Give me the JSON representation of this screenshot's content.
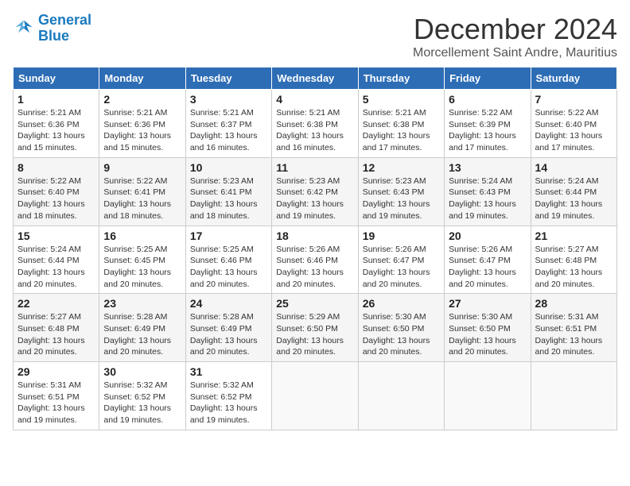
{
  "logo": {
    "line1": "General",
    "line2": "Blue"
  },
  "title": "December 2024",
  "subtitle": "Morcellement Saint Andre, Mauritius",
  "weekdays": [
    "Sunday",
    "Monday",
    "Tuesday",
    "Wednesday",
    "Thursday",
    "Friday",
    "Saturday"
  ],
  "weeks": [
    [
      {
        "day": "1",
        "sunrise": "5:21 AM",
        "sunset": "6:36 PM",
        "daylight": "13 hours and 15 minutes."
      },
      {
        "day": "2",
        "sunrise": "5:21 AM",
        "sunset": "6:36 PM",
        "daylight": "13 hours and 15 minutes."
      },
      {
        "day": "3",
        "sunrise": "5:21 AM",
        "sunset": "6:37 PM",
        "daylight": "13 hours and 16 minutes."
      },
      {
        "day": "4",
        "sunrise": "5:21 AM",
        "sunset": "6:38 PM",
        "daylight": "13 hours and 16 minutes."
      },
      {
        "day": "5",
        "sunrise": "5:21 AM",
        "sunset": "6:38 PM",
        "daylight": "13 hours and 17 minutes."
      },
      {
        "day": "6",
        "sunrise": "5:22 AM",
        "sunset": "6:39 PM",
        "daylight": "13 hours and 17 minutes."
      },
      {
        "day": "7",
        "sunrise": "5:22 AM",
        "sunset": "6:40 PM",
        "daylight": "13 hours and 17 minutes."
      }
    ],
    [
      {
        "day": "8",
        "sunrise": "5:22 AM",
        "sunset": "6:40 PM",
        "daylight": "13 hours and 18 minutes."
      },
      {
        "day": "9",
        "sunrise": "5:22 AM",
        "sunset": "6:41 PM",
        "daylight": "13 hours and 18 minutes."
      },
      {
        "day": "10",
        "sunrise": "5:23 AM",
        "sunset": "6:41 PM",
        "daylight": "13 hours and 18 minutes."
      },
      {
        "day": "11",
        "sunrise": "5:23 AM",
        "sunset": "6:42 PM",
        "daylight": "13 hours and 19 minutes."
      },
      {
        "day": "12",
        "sunrise": "5:23 AM",
        "sunset": "6:43 PM",
        "daylight": "13 hours and 19 minutes."
      },
      {
        "day": "13",
        "sunrise": "5:24 AM",
        "sunset": "6:43 PM",
        "daylight": "13 hours and 19 minutes."
      },
      {
        "day": "14",
        "sunrise": "5:24 AM",
        "sunset": "6:44 PM",
        "daylight": "13 hours and 19 minutes."
      }
    ],
    [
      {
        "day": "15",
        "sunrise": "5:24 AM",
        "sunset": "6:44 PM",
        "daylight": "13 hours and 20 minutes."
      },
      {
        "day": "16",
        "sunrise": "5:25 AM",
        "sunset": "6:45 PM",
        "daylight": "13 hours and 20 minutes."
      },
      {
        "day": "17",
        "sunrise": "5:25 AM",
        "sunset": "6:46 PM",
        "daylight": "13 hours and 20 minutes."
      },
      {
        "day": "18",
        "sunrise": "5:26 AM",
        "sunset": "6:46 PM",
        "daylight": "13 hours and 20 minutes."
      },
      {
        "day": "19",
        "sunrise": "5:26 AM",
        "sunset": "6:47 PM",
        "daylight": "13 hours and 20 minutes."
      },
      {
        "day": "20",
        "sunrise": "5:26 AM",
        "sunset": "6:47 PM",
        "daylight": "13 hours and 20 minutes."
      },
      {
        "day": "21",
        "sunrise": "5:27 AM",
        "sunset": "6:48 PM",
        "daylight": "13 hours and 20 minutes."
      }
    ],
    [
      {
        "day": "22",
        "sunrise": "5:27 AM",
        "sunset": "6:48 PM",
        "daylight": "13 hours and 20 minutes."
      },
      {
        "day": "23",
        "sunrise": "5:28 AM",
        "sunset": "6:49 PM",
        "daylight": "13 hours and 20 minutes."
      },
      {
        "day": "24",
        "sunrise": "5:28 AM",
        "sunset": "6:49 PM",
        "daylight": "13 hours and 20 minutes."
      },
      {
        "day": "25",
        "sunrise": "5:29 AM",
        "sunset": "6:50 PM",
        "daylight": "13 hours and 20 minutes."
      },
      {
        "day": "26",
        "sunrise": "5:30 AM",
        "sunset": "6:50 PM",
        "daylight": "13 hours and 20 minutes."
      },
      {
        "day": "27",
        "sunrise": "5:30 AM",
        "sunset": "6:50 PM",
        "daylight": "13 hours and 20 minutes."
      },
      {
        "day": "28",
        "sunrise": "5:31 AM",
        "sunset": "6:51 PM",
        "daylight": "13 hours and 20 minutes."
      }
    ],
    [
      {
        "day": "29",
        "sunrise": "5:31 AM",
        "sunset": "6:51 PM",
        "daylight": "13 hours and 19 minutes."
      },
      {
        "day": "30",
        "sunrise": "5:32 AM",
        "sunset": "6:52 PM",
        "daylight": "13 hours and 19 minutes."
      },
      {
        "day": "31",
        "sunrise": "5:32 AM",
        "sunset": "6:52 PM",
        "daylight": "13 hours and 19 minutes."
      },
      null,
      null,
      null,
      null
    ]
  ]
}
